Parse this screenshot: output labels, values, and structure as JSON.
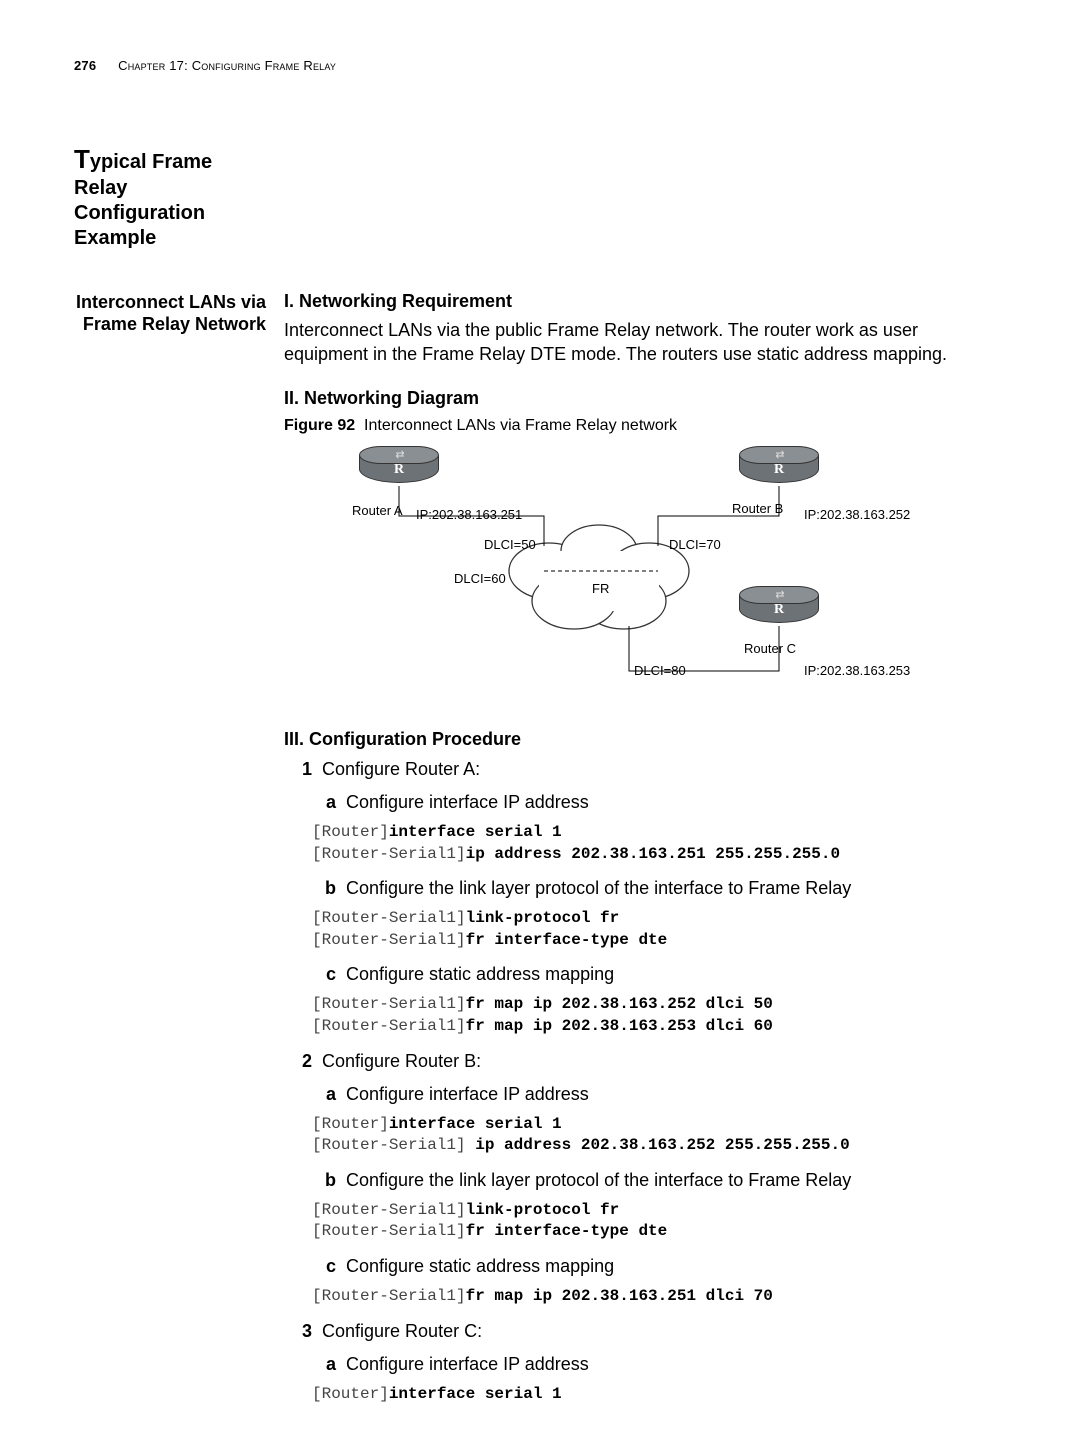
{
  "header": {
    "page_number": "276",
    "chapter": "Chapter 17: Configuring Frame Relay"
  },
  "section_title_line1": "ypical Frame Relay",
  "section_title_line2": "Configuration",
  "section_title_line3": "Example",
  "side_sub_line1": "Interconnect LANs via",
  "side_sub_line2": "Frame Relay Network",
  "h_req": "I. Networking Requirement",
  "req_body": "Interconnect LANs via the public Frame Relay network. The router work as user equipment in the Frame Relay DTE mode. The routers use static address mapping.",
  "h_diag": "II. Networking Diagram",
  "fig_label": "Figure 92",
  "fig_caption": "Interconnect LANs via Frame Relay network",
  "diagram": {
    "routerA": "Router A",
    "routerB": "Router B",
    "routerC": "Router C",
    "ipA": "IP:202.38.163.251",
    "ipB": "IP:202.38.163.252",
    "ipC": "IP:202.38.163.253",
    "dlci50": "DLCI=50",
    "dlci60": "DLCI=60",
    "dlci70": "DLCI=70",
    "dlci80": "DLCI=80",
    "fr": "FR",
    "r_glyph": "R"
  },
  "h_proc": "III. Configuration Procedure",
  "steps": {
    "s1": "Configure Router A:",
    "s1a": "Configure interface IP address",
    "s1b": "Configure the link layer protocol of the interface to Frame Relay",
    "s1c": "Configure static address mapping",
    "s2": "Configure Router B:",
    "s2a": "Configure interface IP address",
    "s2b": "Configure the link layer protocol of the interface to Frame Relay",
    "s2c": "Configure static address mapping",
    "s3": "Configure Router C:",
    "s3a": "Configure interface IP address"
  },
  "code": {
    "p_router": "[Router]",
    "p_serial": "[Router-Serial1]",
    "iface": "interface serial 1",
    "ipA": "ip address 202.38.163.251 255.255.255.0",
    "ipB": " ip address 202.38.163.252 255.255.255.0",
    "linkfr": "link-protocol fr",
    "dte": "fr interface-type dte",
    "map252_50": "fr map ip 202.38.163.252 dlci 50",
    "map253_60": "fr map ip 202.38.163.253 dlci 60",
    "map251_70": "fr map ip 202.38.163.251 dlci 70"
  }
}
